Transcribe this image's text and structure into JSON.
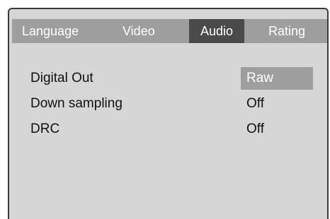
{
  "tabs": [
    {
      "label": "Language",
      "active": false
    },
    {
      "label": "Video",
      "active": false
    },
    {
      "label": "Audio",
      "active": true
    },
    {
      "label": "Rating",
      "active": false
    }
  ],
  "settings": [
    {
      "label": "Digital Out",
      "value": "Raw",
      "selected": true
    },
    {
      "label": "Down sampling",
      "value": "Off",
      "selected": false
    },
    {
      "label": "DRC",
      "value": "Off",
      "selected": false
    }
  ],
  "colors": {
    "panel_background": "#d6d6d6",
    "tab_bar": "#9e9e9e",
    "active_tab": "#4a4a4a",
    "selected_value": "#9e9e9e",
    "border": "#3a3a3a"
  }
}
